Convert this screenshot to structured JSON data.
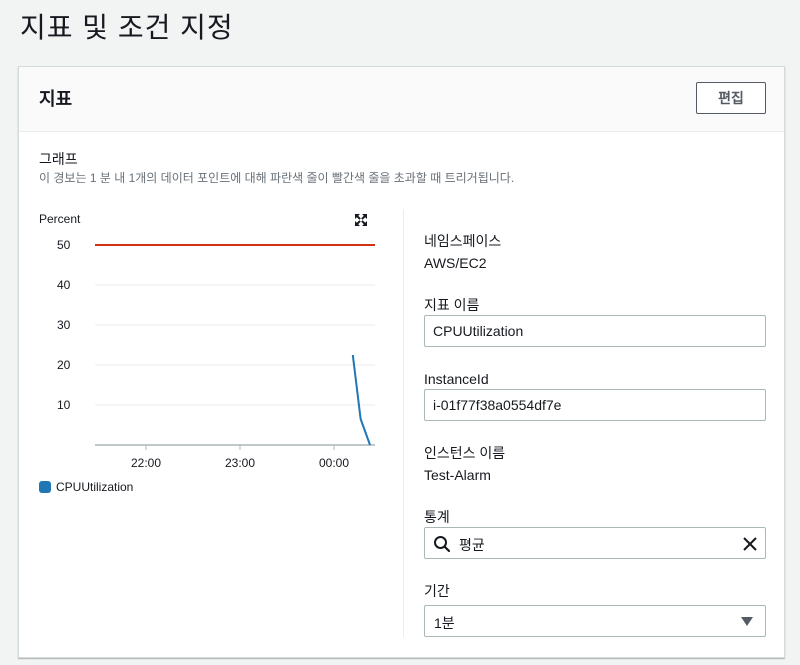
{
  "page": {
    "title": "지표 및 조건 지정"
  },
  "panel": {
    "title": "지표",
    "edit_label": "편집",
    "graph_label": "그래프",
    "graph_description": "이 경보는 1 분 내 1개의 데이터 포인트에 대해 파란색 줄이 빨간색 줄을 초과할 때 트리거됩니다."
  },
  "fields": {
    "namespace_label": "네임스페이스",
    "namespace_value": "AWS/EC2",
    "metric_name_label": "지표 이름",
    "metric_name_value": "CPUUtilization",
    "instance_id_label": "InstanceId",
    "instance_id_value": "i-01f77f38a0554df7e",
    "instance_name_label": "인스턴스 이름",
    "instance_name_value": "Test-Alarm",
    "statistic_label": "통계",
    "statistic_value": "평균",
    "period_label": "기간",
    "period_value": "1분"
  },
  "icons": {
    "expand": "expand-icon",
    "search": "search-icon",
    "clear": "close-icon",
    "caret": "caret-down-icon"
  },
  "colors": {
    "threshold": "#d13212",
    "series": "#1f77b4"
  },
  "chart_data": {
    "type": "line",
    "ylabel": "Percent",
    "yticks": [
      10,
      20,
      30,
      40,
      50
    ],
    "ylim": [
      0,
      50
    ],
    "xticks": [
      "22:00",
      "23:00",
      "00:00"
    ],
    "threshold": 50,
    "series": [
      {
        "name": "CPUUtilization",
        "points": [
          {
            "x": "00:12",
            "y": 22.5
          },
          {
            "x": "00:17",
            "y": 6.5
          },
          {
            "x": "00:23",
            "y": 0
          }
        ]
      }
    ],
    "grid": true,
    "legend": "bottom-left"
  }
}
